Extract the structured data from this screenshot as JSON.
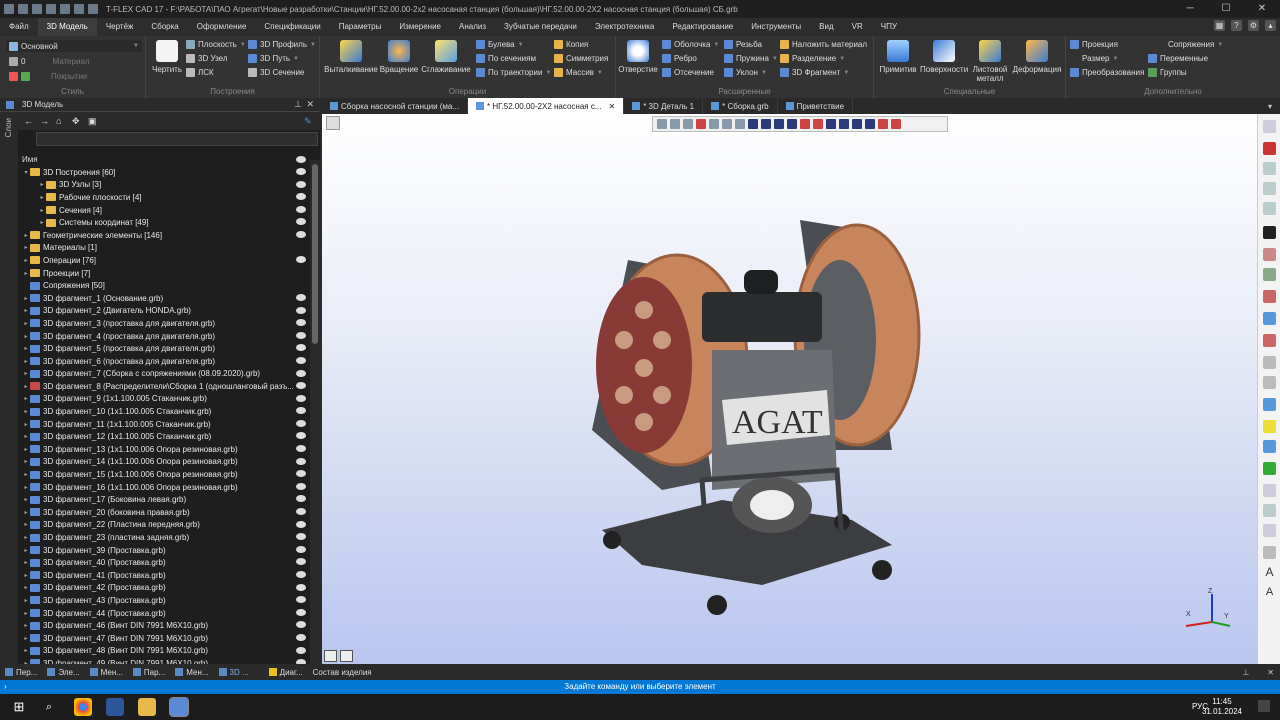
{
  "window": {
    "title": "T-FLEX CAD 17 - F:\\РАБОТА\\ПАО Агрегат\\Новые разработки\\Станции\\НГ.52.00.00-2х2 насосаная станция (большая)\\НГ.52.00.00-2Х2 насосная станция (большая) СБ.grb"
  },
  "menu": [
    "Файл",
    "3D Модель",
    "Чертёж",
    "Сборка",
    "Оформление",
    "Спецификации",
    "Параметры",
    "Измерение",
    "Анализ",
    "Зубчатые передачи",
    "Электротехника",
    "Редактирование",
    "Инструменты",
    "Вид",
    "VR",
    "ЧПУ"
  ],
  "menu_active": "3D Модель",
  "ribbon": {
    "style": {
      "label": "Стиль",
      "layer": "Основной",
      "level": "0",
      "material": "Материал",
      "cover": "Покрытие"
    },
    "build": {
      "label": "Построения",
      "draw": "Чертить",
      "plane": "Плоскость",
      "node": "3D Узел",
      "lsk": "ЛСК",
      "profile": "3D Профиль",
      "path": "3D Путь",
      "section": "3D Сечение"
    },
    "ops": {
      "label": "Операции",
      "extrude": "Выталкивание",
      "rotate": "Вращение",
      "smooth": "Сглаживание",
      "bool": "Булева",
      "by_sections": "По сечениям",
      "by_path": "По траектории",
      "copy": "Копия",
      "symmetry": "Симметрия",
      "array": "Массив"
    },
    "ext": {
      "label": "Расширенные",
      "hole": "Отверстие",
      "shell": "Оболочка",
      "rib": "Ребро",
      "cut": "Отсечение",
      "thread": "Резьба",
      "spring": "Пружина",
      "slope": "Уклон",
      "apply_material": "Наложить материал",
      "split": "Разделение",
      "fragment": "3D Фрагмент"
    },
    "special": {
      "label": "Специальные",
      "primitive": "Примитив",
      "surface": "Поверхности",
      "sheet": "Листовой металл",
      "deform": "Деформация"
    },
    "extra": {
      "label": "Дополнительно",
      "projection": "Проекция",
      "size": "Размер",
      "transform": "Преобразования",
      "mates": "Сопряжения",
      "variables": "Переменные",
      "groups": "Группы"
    }
  },
  "left_panel": {
    "title": "3D Модель",
    "side_tab": "Слои",
    "column_name": "Имя"
  },
  "tree": [
    {
      "label": "3D Построения [60]",
      "lvl": 0,
      "exp": "open",
      "icon": "folder",
      "eye": true
    },
    {
      "label": "3D Узлы [3]",
      "lvl": 1,
      "exp": "closed",
      "icon": "folder",
      "eye": true
    },
    {
      "label": "Рабочие плоскости [4]",
      "lvl": 1,
      "exp": "closed",
      "icon": "folder",
      "eye": true
    },
    {
      "label": "Сечения [4]",
      "lvl": 1,
      "exp": "closed",
      "icon": "folder",
      "eye": true
    },
    {
      "label": "Системы координат [49]",
      "lvl": 1,
      "exp": "closed",
      "icon": "folder",
      "eye": true
    },
    {
      "label": "Геометрические элементы [146]",
      "lvl": 0,
      "exp": "closed",
      "icon": "folder",
      "eye": true
    },
    {
      "label": "Материалы [1]",
      "lvl": 0,
      "exp": "closed",
      "icon": "folder",
      "eye": false
    },
    {
      "label": "Операции [76]",
      "lvl": 0,
      "exp": "closed",
      "icon": "folder",
      "eye": true
    },
    {
      "label": "Проекции [7]",
      "lvl": 0,
      "exp": "closed",
      "icon": "folder",
      "eye": false
    },
    {
      "label": "Сопряжения [50]",
      "lvl": 0,
      "exp": "none",
      "icon": "mate",
      "eye": false
    },
    {
      "label": "3D фрагмент_1 (Основание.grb)",
      "lvl": 0,
      "exp": "closed",
      "icon": "frag",
      "eye": true
    },
    {
      "label": "3D фрагмент_2 (Двигатель HONDA.grb)",
      "lvl": 0,
      "exp": "closed",
      "icon": "frag",
      "eye": true
    },
    {
      "label": "3D фрагмент_3 (проставка для двигателя.grb)",
      "lvl": 0,
      "exp": "closed",
      "icon": "frag",
      "eye": true
    },
    {
      "label": "3D фрагмент_4 (проставка для двигателя.grb)",
      "lvl": 0,
      "exp": "closed",
      "icon": "frag",
      "eye": true
    },
    {
      "label": "3D фрагмент_5 (проставка для двигателя.grb)",
      "lvl": 0,
      "exp": "closed",
      "icon": "frag",
      "eye": true
    },
    {
      "label": "3D фрагмент_6 (проставка для двигателя.grb)",
      "lvl": 0,
      "exp": "closed",
      "icon": "frag",
      "eye": true
    },
    {
      "label": "3D фрагмент_7 (Сборка с сопряжениями (08.09.2020).grb)",
      "lvl": 0,
      "exp": "closed",
      "icon": "frag",
      "eye": true
    },
    {
      "label": "3D фрагмент_8 (Распределители\\Сборка 1 (одношланговый разъ...",
      "lvl": 0,
      "exp": "closed",
      "icon": "fragred",
      "eye": true
    },
    {
      "label": "3D фрагмент_9 (1x1.100.005 Стаканчик.grb)",
      "lvl": 0,
      "exp": "closed",
      "icon": "frag",
      "eye": true
    },
    {
      "label": "3D фрагмент_10 (1x1.100.005 Стаканчик.grb)",
      "lvl": 0,
      "exp": "closed",
      "icon": "frag",
      "eye": true
    },
    {
      "label": "3D фрагмент_11 (1x1.100.005 Стаканчик.grb)",
      "lvl": 0,
      "exp": "closed",
      "icon": "frag",
      "eye": true
    },
    {
      "label": "3D фрагмент_12 (1x1.100.005 Стаканчик.grb)",
      "lvl": 0,
      "exp": "closed",
      "icon": "frag",
      "eye": true
    },
    {
      "label": "3D фрагмент_13 (1x1.100.006 Опора резиновая.grb)",
      "lvl": 0,
      "exp": "closed",
      "icon": "frag",
      "eye": true
    },
    {
      "label": "3D фрагмент_14 (1x1.100.006 Опора резиновая.grb)",
      "lvl": 0,
      "exp": "closed",
      "icon": "frag",
      "eye": true
    },
    {
      "label": "3D фрагмент_15 (1x1.100.006 Опора резиновая.grb)",
      "lvl": 0,
      "exp": "closed",
      "icon": "frag",
      "eye": true
    },
    {
      "label": "3D фрагмент_16 (1x1.100.006 Опора резиновая.grb)",
      "lvl": 0,
      "exp": "closed",
      "icon": "frag",
      "eye": true
    },
    {
      "label": "3D фрагмент_17 (Боковина левая.grb)",
      "lvl": 0,
      "exp": "closed",
      "icon": "frag",
      "eye": true
    },
    {
      "label": "3D фрагмент_20 (боковина правая.grb)",
      "lvl": 0,
      "exp": "closed",
      "icon": "frag",
      "eye": true
    },
    {
      "label": "3D фрагмент_22 (Пластина передняя.grb)",
      "lvl": 0,
      "exp": "closed",
      "icon": "frag",
      "eye": true
    },
    {
      "label": "3D фрагмент_23 (пластина задняя.grb)",
      "lvl": 0,
      "exp": "closed",
      "icon": "frag",
      "eye": true
    },
    {
      "label": "3D фрагмент_39 (Проставка.grb)",
      "lvl": 0,
      "exp": "closed",
      "icon": "frag",
      "eye": true
    },
    {
      "label": "3D фрагмент_40 (Проставка.grb)",
      "lvl": 0,
      "exp": "closed",
      "icon": "frag",
      "eye": true
    },
    {
      "label": "3D фрагмент_41 (Проставка.grb)",
      "lvl": 0,
      "exp": "closed",
      "icon": "frag",
      "eye": true
    },
    {
      "label": "3D фрагмент_42 (Проставка.grb)",
      "lvl": 0,
      "exp": "closed",
      "icon": "frag",
      "eye": true
    },
    {
      "label": "3D фрагмент_43 (Проставка.grb)",
      "lvl": 0,
      "exp": "closed",
      "icon": "frag",
      "eye": true
    },
    {
      "label": "3D фрагмент_44 (Проставка.grb)",
      "lvl": 0,
      "exp": "closed",
      "icon": "frag",
      "eye": true
    },
    {
      "label": "3D фрагмент_46 (Винт DIN 7991 M6X10.grb)",
      "lvl": 0,
      "exp": "closed",
      "icon": "frag",
      "eye": true
    },
    {
      "label": "3D фрагмент_47 (Винт DIN 7991 M6X10.grb)",
      "lvl": 0,
      "exp": "closed",
      "icon": "frag",
      "eye": true
    },
    {
      "label": "3D фрагмент_48 (Винт DIN 7991 M6X10.grb)",
      "lvl": 0,
      "exp": "closed",
      "icon": "frag",
      "eye": true
    },
    {
      "label": "3D фрагмент_49 (Винт DIN 7991 M6X10.grb)",
      "lvl": 0,
      "exp": "closed",
      "icon": "frag",
      "eye": true
    }
  ],
  "doc_tabs": [
    {
      "label": "Сборка насосной станции (ма...",
      "active": false
    },
    {
      "label": "* НГ.52.00.00-2Х2 насосная с...",
      "active": true
    },
    {
      "label": "* 3D Деталь 1",
      "active": false
    },
    {
      "label": "* Сборка.grb",
      "active": false
    },
    {
      "label": "Приветствие",
      "active": false
    }
  ],
  "model": {
    "brand_text": "AGAT"
  },
  "axes": {
    "x": "X",
    "y": "Y",
    "z": "Z"
  },
  "bottom_tabs": [
    "Пер...",
    "Эле...",
    "Мен...",
    "Пар...",
    "Мен...",
    "3D ...",
    "Диаг...",
    "Состав изделия"
  ],
  "status_text": "Задайте команду или выберите элемент",
  "taskbar": {
    "lang": "РУС",
    "time": "11:45",
    "date": "31.01.2024"
  },
  "colors": {
    "accent": "#0078d4",
    "viewport_top": "#ffffff",
    "viewport_bottom": "#b9c6ee",
    "hose": "#c8845a",
    "frame": "#4a4d52",
    "disc": "#8a3a36"
  }
}
